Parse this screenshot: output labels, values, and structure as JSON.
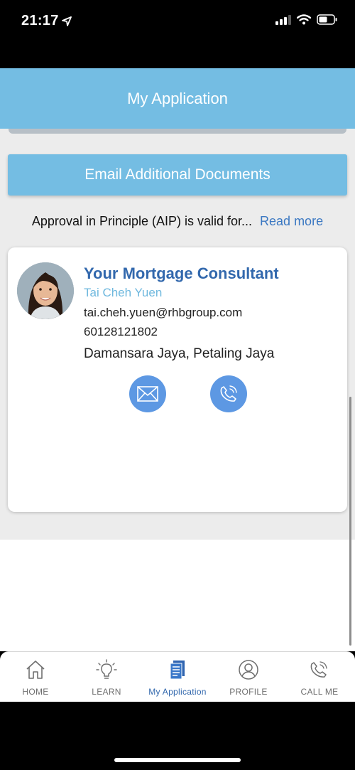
{
  "status_bar": {
    "time": "21:17"
  },
  "header": {
    "title": "My Application"
  },
  "actions": {
    "email_documents_label": "Email Additional Documents"
  },
  "aip_notice": {
    "text": "Approval in Principle (AIP) is valid for...",
    "read_more": "Read more"
  },
  "consultant": {
    "title": "Your Mortgage Consultant",
    "name": "Tai Cheh Yuen",
    "email": "tai.cheh.yuen@rhbgroup.com",
    "phone": "60128121802",
    "location": "Damansara Jaya, Petaling Jaya"
  },
  "tab_bar": {
    "items": [
      {
        "label": "HOME",
        "icon": "home-icon"
      },
      {
        "label": "LEARN",
        "icon": "lightbulb-icon"
      },
      {
        "label": "My Application",
        "icon": "document-icon",
        "active": true
      },
      {
        "label": "PROFILE",
        "icon": "profile-icon"
      },
      {
        "label": "CALL ME",
        "icon": "phone-icon"
      }
    ]
  },
  "colors": {
    "header_blue": "#74bde3",
    "accent_blue": "#3268ad",
    "button_blue": "#5d98e3",
    "name_blue": "#6fb8de"
  }
}
